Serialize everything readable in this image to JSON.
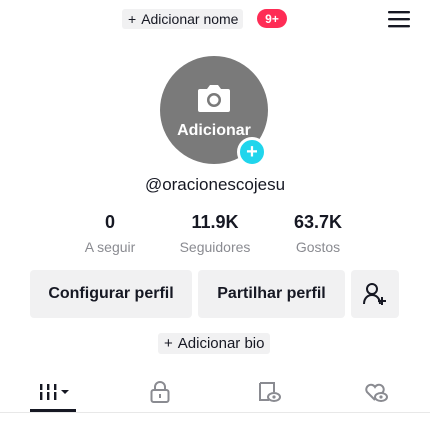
{
  "header": {
    "add_name_plus": "+",
    "add_name_label": "Adicionar nome",
    "notification_badge": "9+",
    "menu_icon": "hamburger-menu-icon"
  },
  "profile": {
    "avatar_label": "Adicionar",
    "avatar_icon": "camera-icon",
    "username": "@oracionescojesu"
  },
  "stats": [
    {
      "value": "0",
      "label": "A seguir"
    },
    {
      "value": "11.9K",
      "label": "Seguidores"
    },
    {
      "value": "63.7K",
      "label": "Gostos"
    }
  ],
  "actions": {
    "edit_profile": "Configurar perfil",
    "share_profile": "Partilhar perfil",
    "add_friend_icon": "add-user-icon"
  },
  "bio": {
    "plus": "+",
    "label": "Adicionar bio"
  },
  "tabs": [
    {
      "icon": "videos-grid-icon",
      "active": true
    },
    {
      "icon": "lock-icon",
      "active": false
    },
    {
      "icon": "repost-icon",
      "active": false
    },
    {
      "icon": "liked-heart-icon",
      "active": false
    }
  ],
  "colors": {
    "badge": "#fe2c55",
    "avatar_plus": "#20d5ec",
    "button_bg": "#f1f1f2",
    "text": "#161823",
    "muted": "#8a8b91"
  }
}
